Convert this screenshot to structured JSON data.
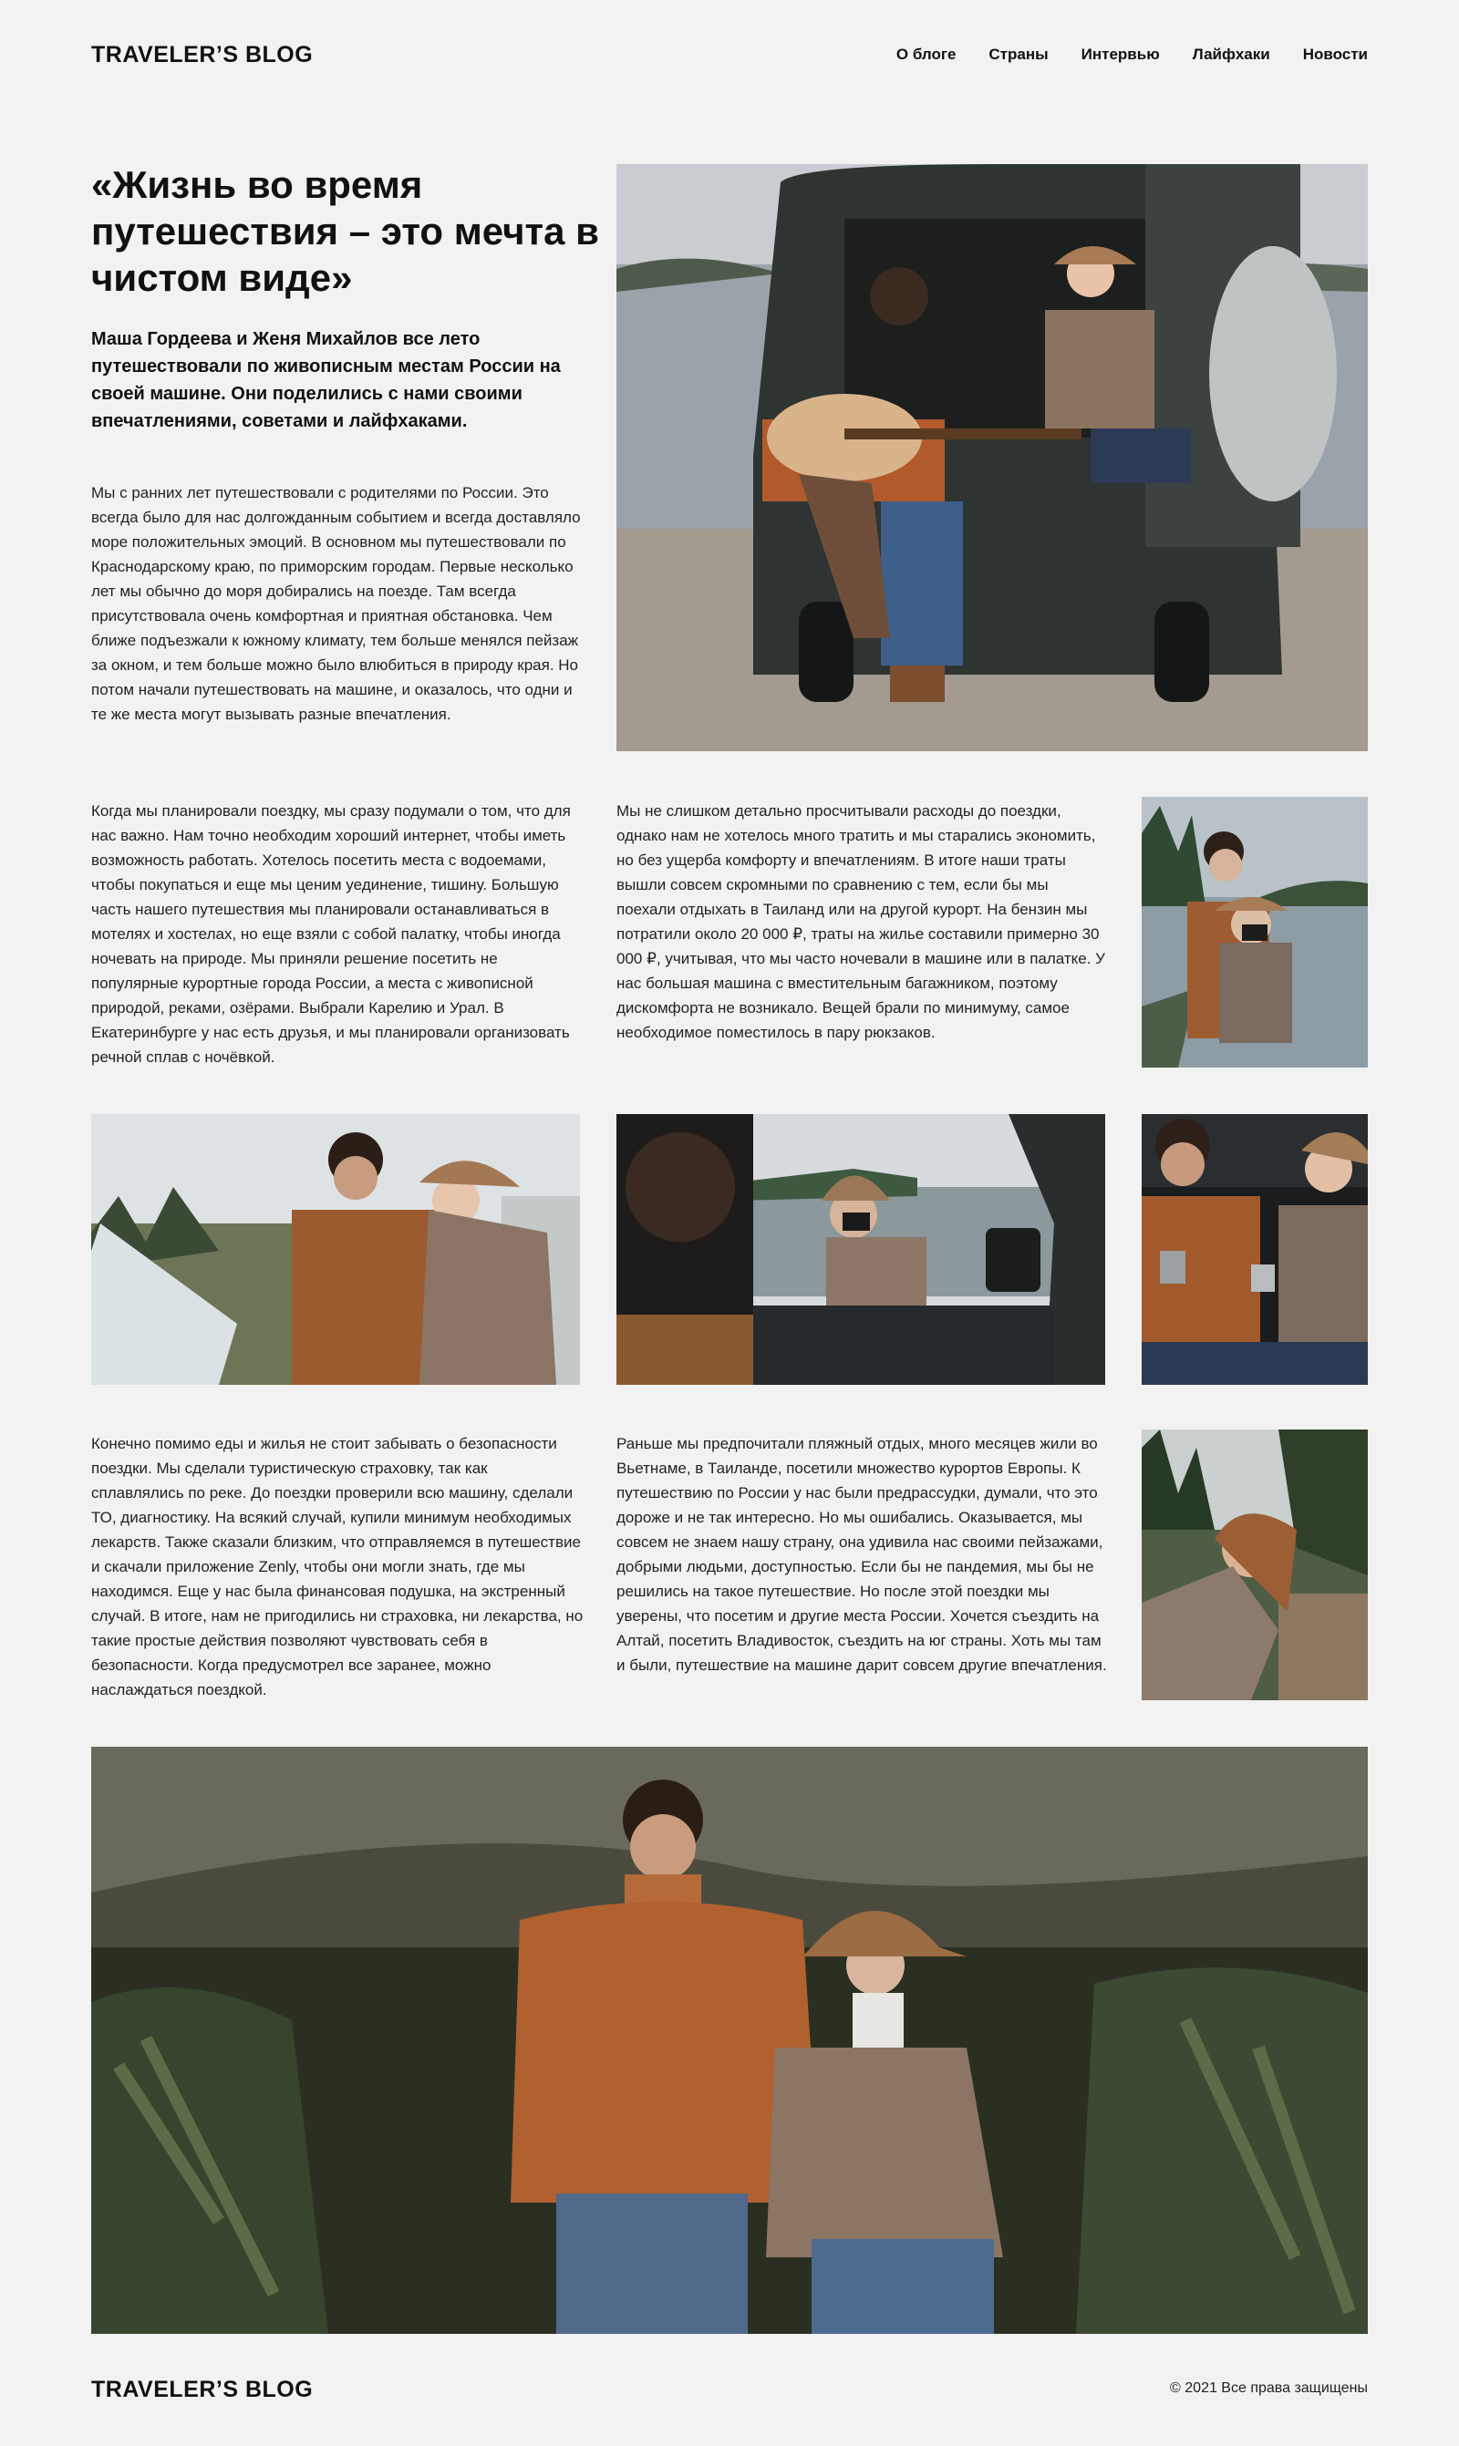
{
  "header": {
    "logo": "TRAVELER’S BLOG",
    "nav": [
      "О блоге",
      "Страны",
      "Интервью",
      "Лайфхаки",
      "Новости"
    ]
  },
  "article": {
    "title": "«Жизнь во время путешествия – это мечта в чистом виде»",
    "lead": "Маша Гордеева и Женя Михайлов все лето путешествовали  по живописным местам России на своей машине. Они поделились с нами своими впечатлениями, советами и лайфхаками.",
    "p1": "Мы с ранних лет путешествовали с родителями по России. Это всегда было для нас долгожданным событием и всегда доставляло море положительных эмоций. В основном мы путешествовали по Краснодарскому краю, по приморским городам. Первые несколько лет мы обычно до моря добирались на поезде. Там всегда присутствовала очень комфортная и приятная обстановка. Чем ближе подъезжали к южному климату, тем больше менялся пейзаж за окном, и тем больше можно было влюбиться в природу края. Но потом начали путешествовать на машине, и оказалось, что одни и те же места могут вызывать разные впечатления.",
    "p2": "Когда мы планировали поездку, мы сразу подумали о том, что для нас важно. Нам точно необходим хороший интернет, чтобы иметь возможность работать. Хотелось посетить места с водоемами, чтобы покупаться и еще мы ценим уединение, тишину. Большую часть нашего путешествия мы планировали останавливаться в мотелях и хостелах, но еще взяли с собой палатку, чтобы иногда ночевать на природе. Мы приняли решение посетить не популярные курортные города России, а места с живописной природой, реками, озёрами. Выбрали Карелию и Урал. В Екатеринбурге у нас есть друзья, и мы планировали организовать речной сплав с ночёвкой.",
    "p3": "Мы не слишком детально просчитывали расходы до поездки, однако нам не хотелось много тратить и мы старались экономить, но без ущерба комфорту и впечатлениям. В итоге наши траты вышли совсем скромными по сравнению с тем, если бы мы поехали отдыхать в Таиланд или на другой курорт. На бензин мы потратили около 20 000 ₽, траты на жилье составили примерно 30 000 ₽, учитывая, что мы часто ночевали в машине или в палатке. У нас большая машина с вместительным багажником, поэтому дискомфорта не возникало. Вещей брали по минимуму, самое необходимое поместилось в пару рюкзаков.",
    "p4": "Конечно помимо еды и жилья не стоит забывать о безопасности поездки. Мы сделали туристическую страховку, так как сплавлялись по реке. До поездки проверили всю машину, сделали ТО, диагностику. На всякий случай, купили минимум необходимых лекарств. Также сказали близким, что отправляемся в путешествие и скачали приложение Zenly, чтобы они могли знать, где мы находимся. Еще у нас была финансовая подушка, на экстренный случай. В итоге, нам не пригодились ни страховка, ни лекарства, но такие простые действия позволяют чувствовать себя в безопасности. Когда предусмотрел все заранее, можно наслаждаться поездкой.",
    "p5": "Раньше мы предпочитали пляжный отдых, много месяцев жили во Вьетнаме, в Таиланде, посетили множество курортов Европы. К путешествию по России у нас были предрассудки, думали, что это дороже и не так интересно. Но мы ошибались. Оказывается, мы совсем не знаем нашу страну, она удивила нас своими пейзажами, добрыми людьми, доступностью. Если бы не пандемия, мы бы не решились на такое путешествие. Но после этой поездки мы уверены, что посетим и другие места России. Хочется съездить на Алтай, посетить Владивосток, съездить на юг страны. Хоть мы там и были, путешествие на машине дарит совсем другие впечатления."
  },
  "footer": {
    "logo": "TRAVELER’S BLOG",
    "copyright": "© 2021 Все права защищены"
  }
}
